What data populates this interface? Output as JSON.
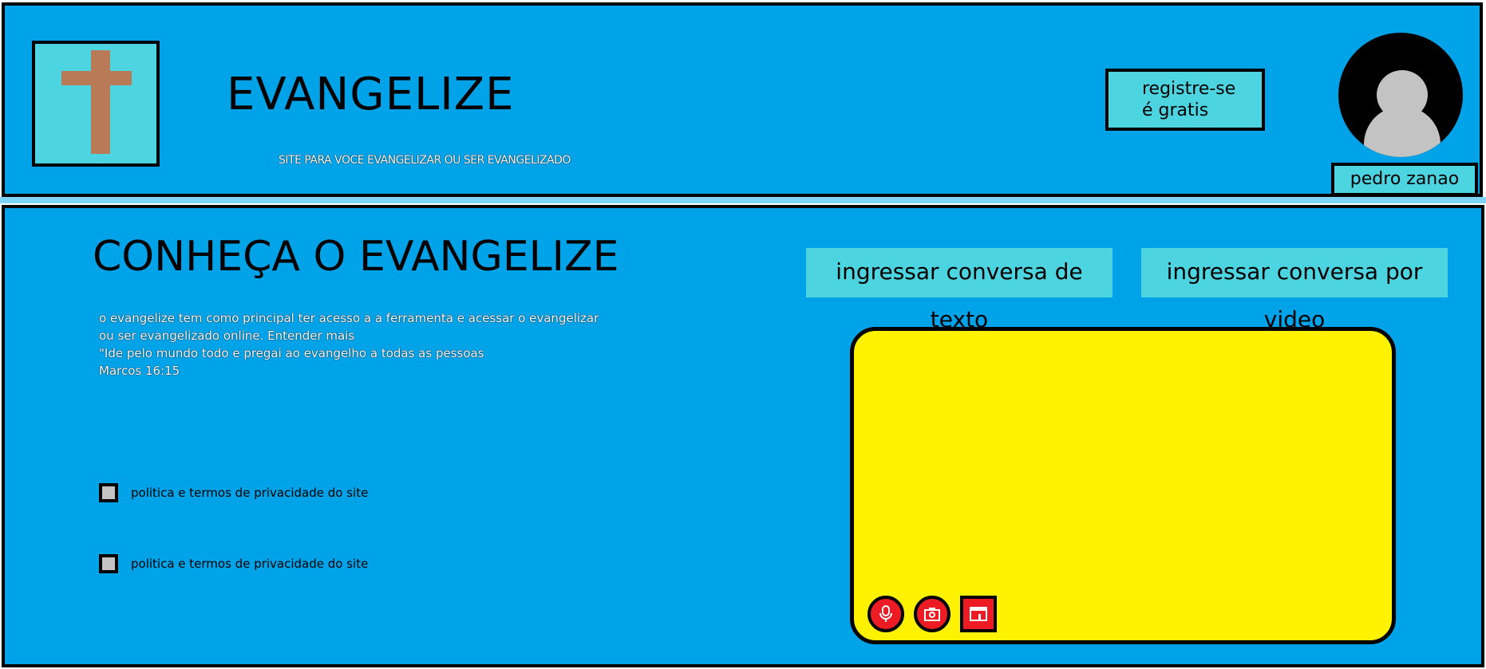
{
  "header": {
    "brand": "EVANGELIZE",
    "tagline": "SITE PARA VOCE  EVANGELIZAR OU SER EVANGELIZADO",
    "register_line1": "registre-se",
    "register_line2": "é gratis",
    "username": "pedro zanao"
  },
  "main": {
    "title": "CONHEÇA O EVANGELIZE",
    "description": [
      "o evangelize tem como principal ter acesso a a ferramenta e acessar o evangelizar",
      "ou ser evangelizado online. Entender mais",
      "\"Ide pelo mundo todo e pregai ao evangelho a todas as pessoas",
      "Marcos 16:15"
    ],
    "policy_1": "politica e termos de privacidade do site",
    "policy_2": "politica e termos de privacidade do site",
    "join_text_chat": "ingressar conversa de texto",
    "join_video_chat": "ingressar conversa por video"
  },
  "colors": {
    "background": "#00a2e8",
    "button": "#4cd4e0",
    "video_area": "#fff200",
    "control": "#ed1c24",
    "cross": "#b97a57"
  },
  "icons": {
    "logo": "cross-icon",
    "avatar": "user-avatar-icon",
    "mic": "microphone-icon",
    "camera": "camera-icon",
    "screen": "window-icon"
  }
}
